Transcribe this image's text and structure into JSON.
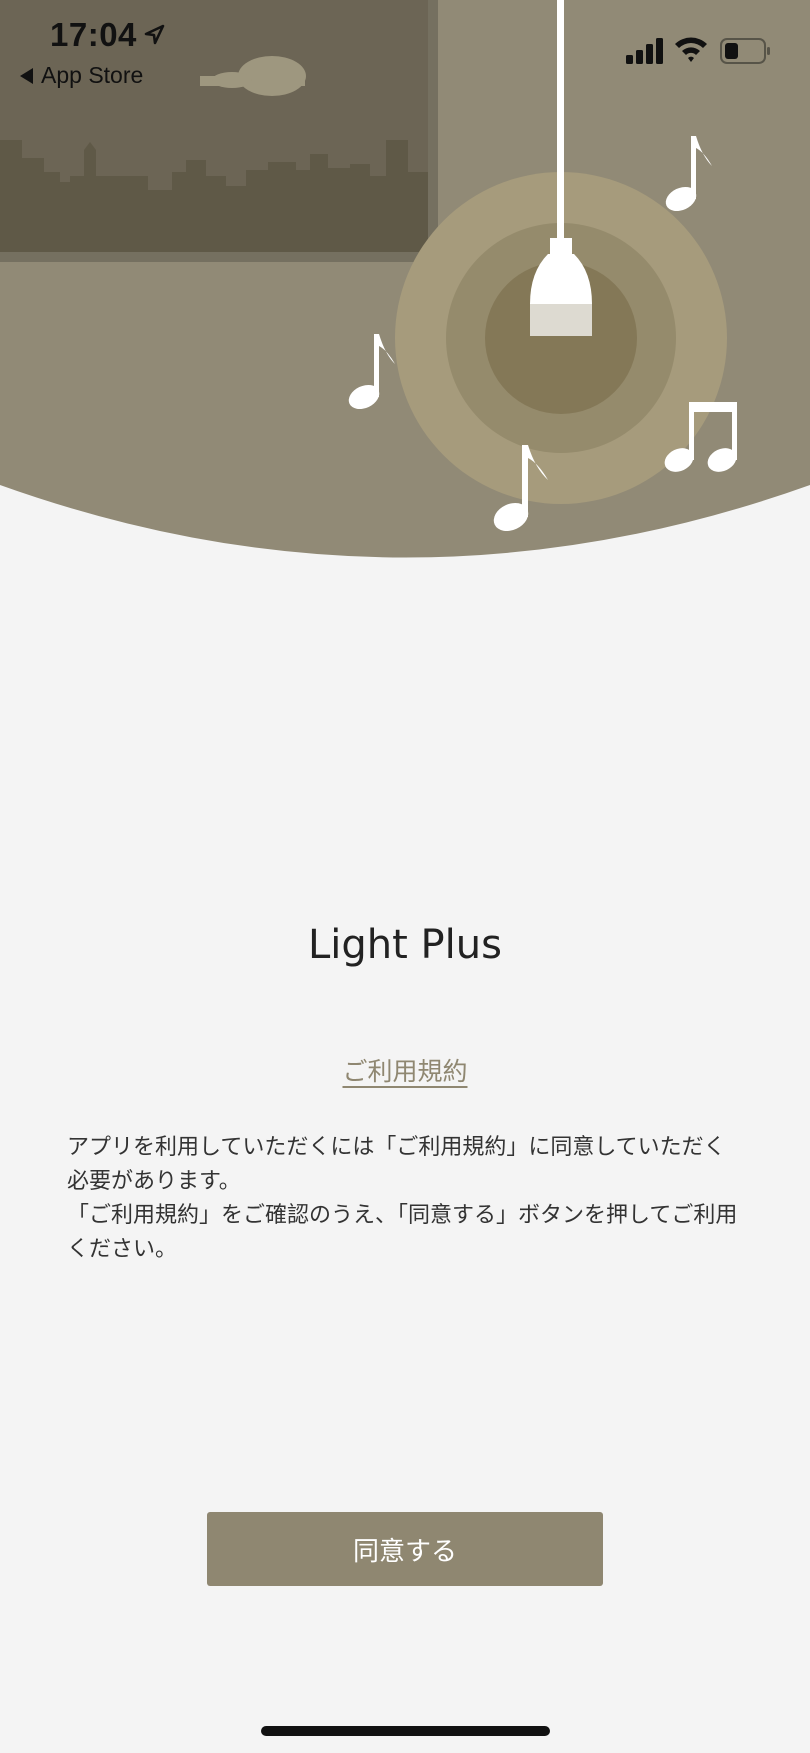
{
  "status_bar": {
    "time": "17:04",
    "back_label": "App Store",
    "icons": [
      "location-arrow-icon",
      "signal-icon",
      "wifi-icon",
      "battery-icon"
    ]
  },
  "hero": {
    "illustration": [
      "city-skyline-window",
      "pendant-lamp-icon",
      "music-note-icons",
      "cloud-icon"
    ]
  },
  "main": {
    "app_title": "Light Plus",
    "terms_link": "ご利用規約",
    "terms_text": "アプリを利用していただくには「ご利用規約」に同意していただく必要があります。\n「ご利用規約」をご確認のうえ、「同意する」ボタンを押してご利用ください。",
    "agree_button": "同意する"
  },
  "colors": {
    "accent": "#8f8771",
    "background": "#f4f4f4",
    "hero": "#918a76",
    "window_frame": "#6d6656",
    "glow": "#a69b7c"
  }
}
